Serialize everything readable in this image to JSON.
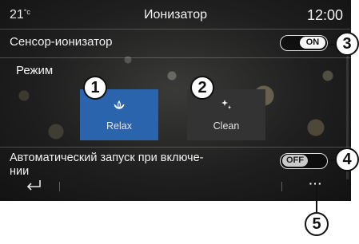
{
  "header": {
    "temperature": "21",
    "temperature_unit": "°c",
    "title": "Ионизатор",
    "clock": "12:00"
  },
  "sensor_row": {
    "label": "Сенсор-ионизатор",
    "toggle_state": "ON"
  },
  "mode_section": {
    "label": "Режим",
    "options": [
      {
        "label": "Relax",
        "icon": "lotus-icon",
        "selected": true
      },
      {
        "label": "Clean",
        "icon": "sparkle-icon",
        "selected": false
      }
    ]
  },
  "auto_start_row": {
    "label": "Автоматический запуск при включении",
    "label_line1": "Автоматический запуск при включе-",
    "label_line2": "нии",
    "toggle_state": "OFF"
  },
  "bottom_bar": {
    "back_icon": "back-arrow-icon",
    "more_label": "···"
  },
  "callouts": [
    "1",
    "2",
    "3",
    "4",
    "5"
  ],
  "colors": {
    "selected_mode": "#2a64ad",
    "unselected_mode": "#333333",
    "background": "#1f1f1f"
  }
}
